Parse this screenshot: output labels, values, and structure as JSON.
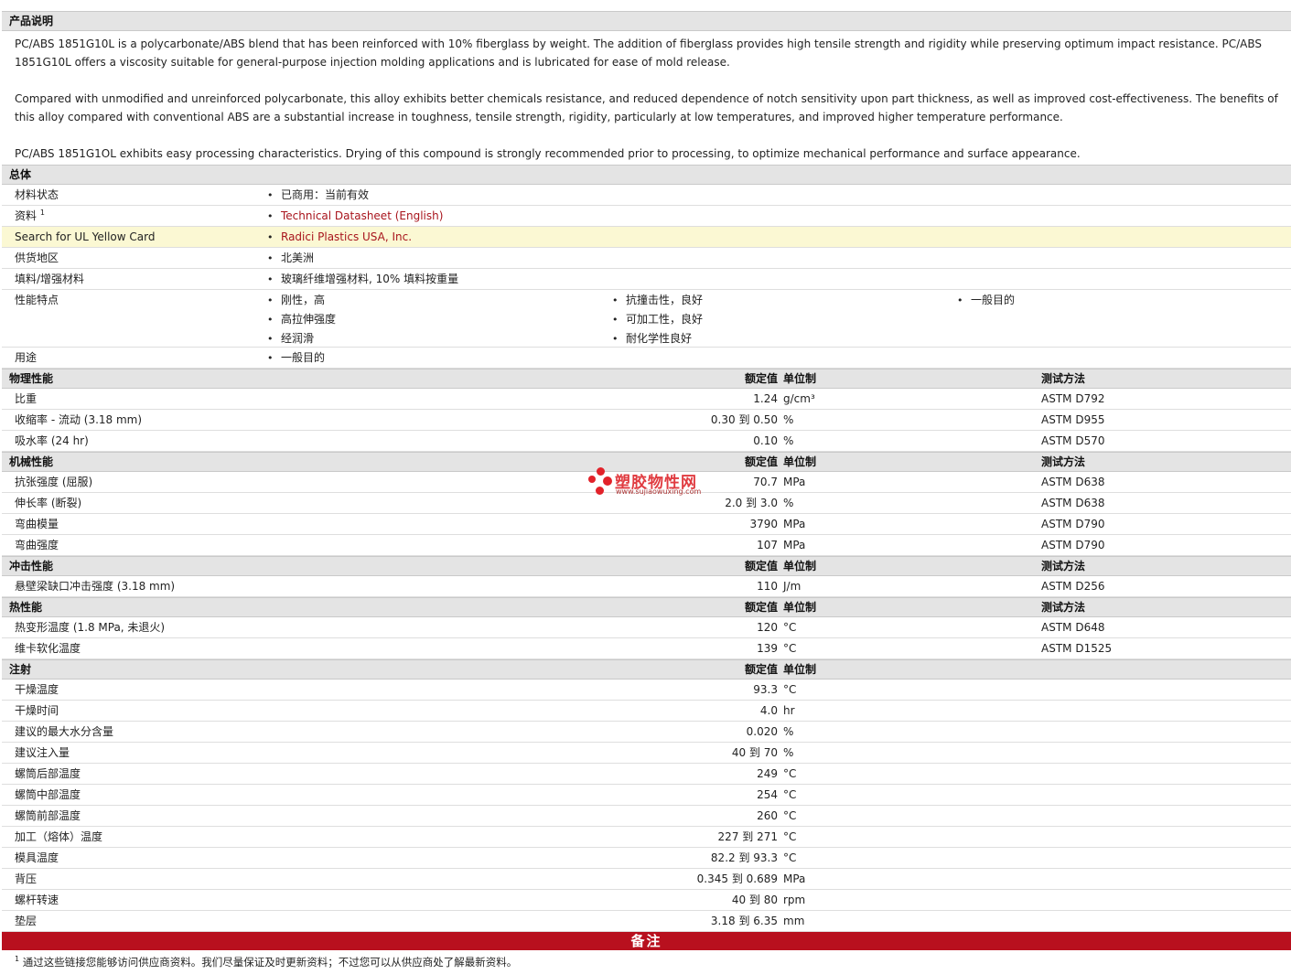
{
  "description": {
    "title": "产品说明",
    "paragraphs": [
      "PC/ABS 1851G10L is a polycarbonate/ABS blend that has been reinforced with 10% fiberglass by weight. The addition of fiberglass provides high tensile strength and rigidity while preserving optimum impact resistance. PC/ABS 1851G10L offers a viscosity suitable for general-purpose injection molding applications and is lubricated for ease of mold release.",
      "Compared with unmodified and unreinforced polycarbonate, this alloy exhibits better chemicals resistance, and reduced dependence of notch sensitivity upon part thickness, as well as improved cost-effectiveness. The benefits of this alloy compared with conventional ABS are a substantial increase in toughness, tensile strength, rigidity, particularly at low temperatures, and improved higher temperature performance.",
      "PC/ABS 1851G1OL exhibits easy processing characteristics. Drying of this compound is strongly recommended prior to processing, to optimize mechanical performance and surface appearance."
    ]
  },
  "general": {
    "title": "总体",
    "status_label": "材料状态",
    "status_value": "已商用：当前有效",
    "docs_label": "资料",
    "docs_sup": "1",
    "docs_link": "Technical Datasheet (English)",
    "ul_label": "Search for UL Yellow Card",
    "ul_link": "Radici Plastics USA, Inc.",
    "region_label": "供货地区",
    "region_value": "北美洲",
    "filler_label": "填料/增强材料",
    "filler_value": "玻璃纤维增强材料, 10% 填料按重量",
    "features_label": "性能特点",
    "features_col1": [
      "刚性，高",
      "高拉伸强度",
      "经润滑"
    ],
    "features_col2": [
      "抗撞击性，良好",
      "可加工性，良好",
      "耐化学性良好"
    ],
    "features_col3": [
      "一般目的"
    ],
    "uses_label": "用途",
    "uses_value": "一般目的"
  },
  "headers": {
    "nominal": "额定值",
    "unit": "单位制",
    "method": "测试方法"
  },
  "physical": {
    "title": "物理性能",
    "rows": [
      {
        "label": "比重",
        "value": "1.24",
        "unit": "g/cm³",
        "method": "ASTM D792"
      },
      {
        "label": "收缩率 - 流动 (3.18 mm)",
        "value": "0.30 到 0.50",
        "unit": "%",
        "method": "ASTM D955"
      },
      {
        "label": "吸水率 (24 hr)",
        "value": "0.10",
        "unit": "%",
        "method": "ASTM D570"
      }
    ]
  },
  "mechanical": {
    "title": "机械性能",
    "rows": [
      {
        "label": "抗张强度 (屈服)",
        "value": "70.7",
        "unit": "MPa",
        "method": "ASTM D638"
      },
      {
        "label": "伸长率 (断裂)",
        "value": "2.0 到 3.0",
        "unit": "%",
        "method": "ASTM D638"
      },
      {
        "label": "弯曲模量",
        "value": "3790",
        "unit": "MPa",
        "method": "ASTM D790"
      },
      {
        "label": "弯曲强度",
        "value": "107",
        "unit": "MPa",
        "method": "ASTM D790"
      }
    ]
  },
  "impact": {
    "title": "冲击性能",
    "rows": [
      {
        "label": "悬壁梁缺口冲击强度 (3.18 mm)",
        "value": "110",
        "unit": "J/m",
        "method": "ASTM D256"
      }
    ]
  },
  "thermal": {
    "title": "热性能",
    "rows": [
      {
        "label": "热变形温度 (1.8 MPa, 未退火)",
        "value": "120",
        "unit": "°C",
        "method": "ASTM D648"
      },
      {
        "label": "维卡软化温度",
        "value": "139",
        "unit": "°C",
        "method": "ASTM D1525"
      }
    ]
  },
  "injection": {
    "title": "注射",
    "rows": [
      {
        "label": "干燥温度",
        "value": "93.3",
        "unit": "°C"
      },
      {
        "label": "干燥时间",
        "value": "4.0",
        "unit": "hr"
      },
      {
        "label": "建议的最大水分含量",
        "value": "0.020",
        "unit": "%"
      },
      {
        "label": "建议注入量",
        "value": "40 到 70",
        "unit": "%"
      },
      {
        "label": "螺筒后部温度",
        "value": "249",
        "unit": "°C"
      },
      {
        "label": "螺筒中部温度",
        "value": "254",
        "unit": "°C"
      },
      {
        "label": "螺筒前部温度",
        "value": "260",
        "unit": "°C"
      },
      {
        "label": "加工（熔体）温度",
        "value": "227 到 271",
        "unit": "°C"
      },
      {
        "label": "模具温度",
        "value": "82.2 到 93.3",
        "unit": "°C"
      },
      {
        "label": "背压",
        "value": "0.345 到 0.689",
        "unit": "MPa"
      },
      {
        "label": "螺杆转速",
        "value": "40 到 80",
        "unit": "rpm"
      },
      {
        "label": "垫层",
        "value": "3.18 到 6.35",
        "unit": "mm"
      }
    ]
  },
  "notes": {
    "title": "备注",
    "sup": "1",
    "text": "通过这些链接您能够访问供应商资料。我们尽量保证及时更新资料；不过您可以从供应商处了解最新资料。"
  },
  "watermark": {
    "text": "塑胶物性网",
    "url": "www.sujiaowuxing.com"
  }
}
